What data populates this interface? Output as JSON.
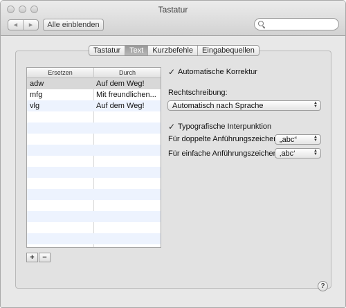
{
  "window": {
    "title": "Tastatur"
  },
  "toolbar": {
    "back_icon": "◀",
    "forward_icon": "▶",
    "show_all_label": "Alle einblenden",
    "search_value": ""
  },
  "tabs": [
    {
      "label": "Tastatur"
    },
    {
      "label": "Text"
    },
    {
      "label": "Kurzbefehle"
    },
    {
      "label": "Eingabequellen"
    }
  ],
  "replacement_table": {
    "col_replace": "Ersetzen",
    "col_with": "Durch",
    "rows": [
      {
        "replace": "adw",
        "with": "Auf dem Weg!"
      },
      {
        "replace": "mfg",
        "with": "Mit freundlichen..."
      },
      {
        "replace": "vlg",
        "with": "Auf dem Weg!"
      }
    ]
  },
  "add_label": "+",
  "remove_label": "−",
  "options": {
    "autocorrect": {
      "check": "✓",
      "label": "Automatische Korrektur"
    },
    "spelling_label": "Rechtschreibung:",
    "spelling_value": "Automatisch nach Sprache",
    "smart_punct": {
      "check": "✓",
      "label": "Typografische Interpunktion"
    },
    "double_quotes_label": "Für doppelte Anführungszeichen",
    "double_quotes_value": "„abc“",
    "single_quotes_label": "Für einfache Anführungszeichen",
    "single_quotes_value": "‚abc‘"
  },
  "help_label": "?"
}
